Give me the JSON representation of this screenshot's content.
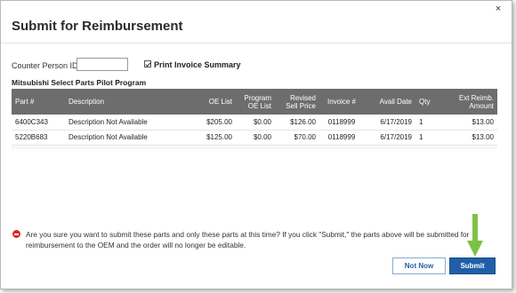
{
  "dialog": {
    "title": "Submit for Reimbursement",
    "close_glyph": "×"
  },
  "form": {
    "counter_label": "Counter Person ID:",
    "counter_value": "",
    "print_invoice_label": "Print Invoice Summary",
    "print_invoice_checked": true
  },
  "program": {
    "title": "Mitsubishi Select Parts Pilot Program"
  },
  "table": {
    "headers": {
      "part": "Part #",
      "description": "Description",
      "oe_list": "OE List",
      "program_oe_list_1": "Program",
      "program_oe_list_2": "OE List",
      "revised_sell_1": "Revised",
      "revised_sell_2": "Sell Price",
      "invoice": "Invoice #",
      "avail_date": "Avail Date",
      "qty": "Qty",
      "ext_reimb_1": "Ext Reimb.",
      "ext_reimb_2": "Amount"
    },
    "rows": [
      {
        "part": "6400C343",
        "description": "Description Not Available",
        "oe_list": "$205.00",
        "program_oe_list": "$0.00",
        "revised_sell": "$126.00",
        "invoice": "0118999",
        "avail_date": "6/17/2019",
        "qty": "1",
        "ext_reimb": "$13.00"
      },
      {
        "part": "5220B683",
        "description": "Description Not Available",
        "oe_list": "$125.00",
        "program_oe_list": "$0.00",
        "revised_sell": "$70.00",
        "invoice": "0118999",
        "avail_date": "6/17/2019",
        "qty": "1",
        "ext_reimb": "$13.00"
      }
    ]
  },
  "warning": {
    "icon": "minus-circle-icon",
    "text": "Are you sure you want to submit these parts and only these parts at this time? If you click \"Submit,\" the parts above will be submitted for reimbursement to the OEM and the order will no longer be editable."
  },
  "buttons": {
    "not_now": "Not Now",
    "submit": "Submit"
  },
  "colors": {
    "header_bg": "#6d6d6d",
    "primary": "#1f5fa8",
    "warning": "#d52b2b",
    "annotation_arrow": "#7dc242"
  }
}
